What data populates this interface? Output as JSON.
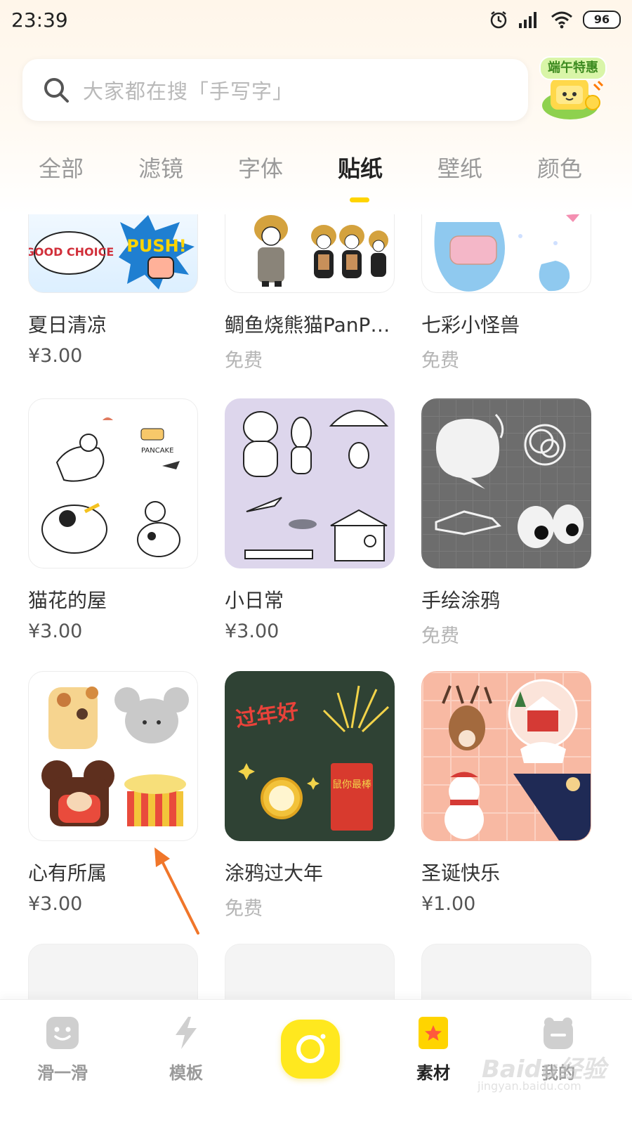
{
  "status_bar": {
    "time": "23:39",
    "battery": "96"
  },
  "search": {
    "placeholder": "大家都在搜「手写字」",
    "promo_label": "端午特惠"
  },
  "tabs": [
    {
      "label": "全部"
    },
    {
      "label": "滤镜"
    },
    {
      "label": "字体"
    },
    {
      "label": "贴纸",
      "active": true
    },
    {
      "label": "壁纸"
    },
    {
      "label": "颜色"
    }
  ],
  "stickers": [
    {
      "title": "夏日清凉",
      "price": "¥3.00",
      "free": false
    },
    {
      "title": "鲷鱼烧熊猫PanP…",
      "price": "免费",
      "free": true
    },
    {
      "title": "七彩小怪兽",
      "price": "免费",
      "free": true
    },
    {
      "title": "猫花的屋",
      "price": "¥3.00",
      "free": false
    },
    {
      "title": "小日常",
      "price": "¥3.00",
      "free": false
    },
    {
      "title": "手绘涂鸦",
      "price": "免费",
      "free": true
    },
    {
      "title": "心有所属",
      "price": "¥3.00",
      "free": false
    },
    {
      "title": "涂鸦过大年",
      "price": "免费",
      "free": true
    },
    {
      "title": "圣诞快乐",
      "price": "¥1.00",
      "free": false
    }
  ],
  "sticker_art_text": {
    "good_choice": "GOOD CHOICE",
    "push": "PUSH!",
    "pancake": "PANCAKE",
    "new_year": "过年好",
    "couplet": "鼠你最棒"
  },
  "bottom_nav": [
    {
      "label": "滑一滑"
    },
    {
      "label": "模板"
    },
    {
      "label": ""
    },
    {
      "label": "素材",
      "active": true
    },
    {
      "label": "我的"
    }
  ],
  "watermark": {
    "text": "Baidu经验",
    "sub": "jingyan.baidu.com"
  },
  "colors": {
    "accent": "#ffd400",
    "active_text": "#222222",
    "inactive_text": "#9a9a9a"
  }
}
